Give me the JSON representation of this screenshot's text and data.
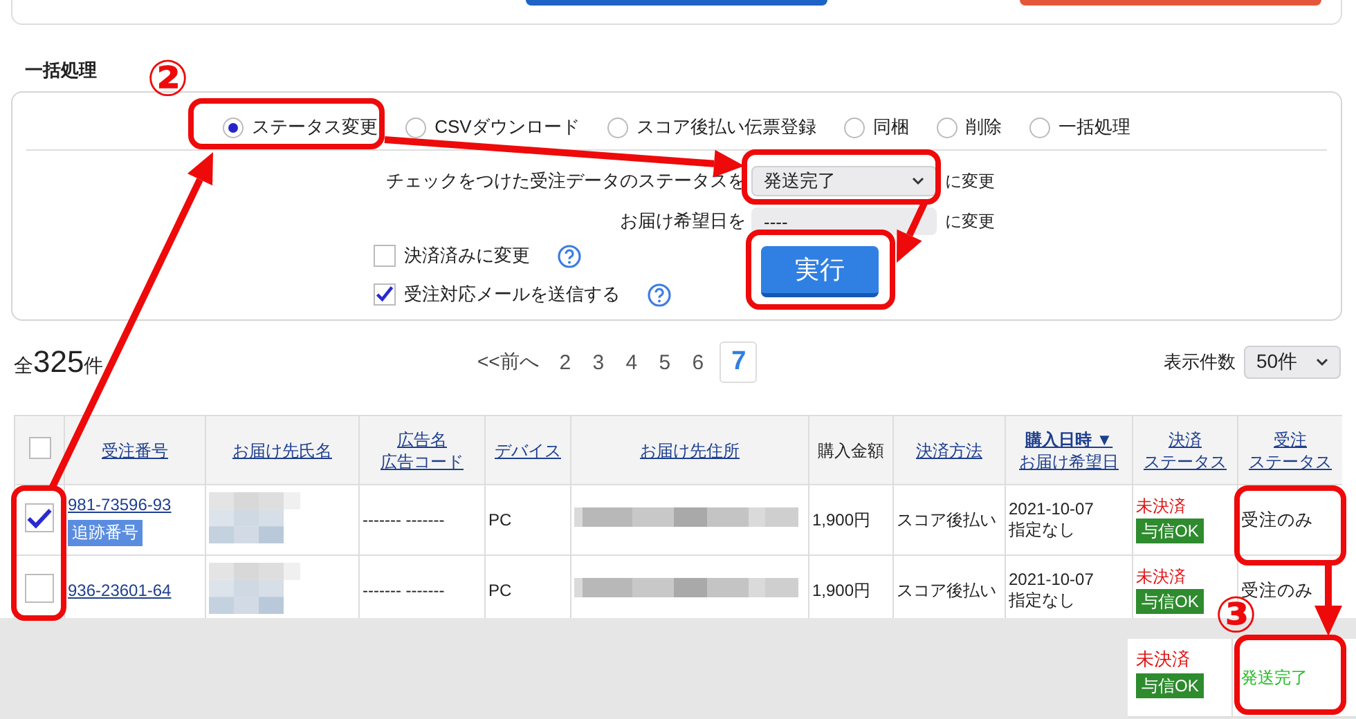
{
  "bulk": {
    "heading": "一括処理",
    "modes": [
      {
        "label": "ステータス変更",
        "selected": true
      },
      {
        "label": "CSVダウンロード",
        "selected": false
      },
      {
        "label": "スコア後払い伝票登録",
        "selected": false
      },
      {
        "label": "同梱",
        "selected": false
      },
      {
        "label": "削除",
        "selected": false
      },
      {
        "label": "一括処理",
        "selected": false
      }
    ],
    "status_row": {
      "label": "チェックをつけた受注データのステータスを",
      "value": "発送完了",
      "suffix": "に変更"
    },
    "date_row": {
      "label": "お届け希望日を",
      "value": "----",
      "suffix": "に変更"
    },
    "options": [
      {
        "label": "決済済みに変更",
        "checked": false
      },
      {
        "label": "受注対応メールを送信する",
        "checked": true
      }
    ],
    "run_button": "実行"
  },
  "summary": {
    "prefix": "全",
    "count": "325",
    "suffix": "件"
  },
  "pagination": {
    "prev": "<<前へ",
    "pages": [
      {
        "label": "2",
        "selected": false
      },
      {
        "label": "3",
        "selected": false
      },
      {
        "label": "4",
        "selected": false
      },
      {
        "label": "5",
        "selected": false
      },
      {
        "label": "6",
        "selected": false
      },
      {
        "label": "7",
        "selected": true
      }
    ]
  },
  "page_size": {
    "label": "表示件数",
    "value": "50件"
  },
  "table": {
    "header_checkbox": {
      "checked": false
    },
    "columns": [
      {
        "lines": [
          "受注番号"
        ],
        "link": true
      },
      {
        "lines": [
          "お届け先氏名"
        ],
        "link": true
      },
      {
        "lines": [
          "広告名",
          "広告コード"
        ],
        "link": true
      },
      {
        "lines": [
          "デバイス"
        ],
        "link": true
      },
      {
        "lines": [
          "お届け先住所"
        ],
        "link": true
      },
      {
        "lines": [
          "購入金額"
        ],
        "link": false
      },
      {
        "lines": [
          "決済方法"
        ],
        "link": true
      },
      {
        "lines": [
          "**購入日時 ▼**",
          "お届け希望日"
        ],
        "link": true
      },
      {
        "lines": [
          "決済",
          "ステータス"
        ],
        "link": true
      },
      {
        "lines": [
          "受注",
          "ステータス"
        ],
        "link": true
      }
    ],
    "rows": [
      {
        "checked": true,
        "order_no": "981-73596-93",
        "tracking": "追跡番号",
        "name_blurred": true,
        "ad": "------- -------",
        "device": "PC",
        "address_blurred": true,
        "amount": "1,900円",
        "method": "スコア後払い",
        "date": "2021-10-07",
        "delivery": "指定なし",
        "payment_status": "未決済",
        "credit": "与信OK",
        "order_status": {
          "label": "受注のみ",
          "color": "#222222"
        }
      },
      {
        "checked": false,
        "order_no": "936-23601-64",
        "name_blurred": true,
        "ad": "------- -------",
        "device": "PC",
        "address_blurred": true,
        "amount": "1,900円",
        "method": "スコア後払い",
        "date": "2021-10-07",
        "delivery": "指定なし",
        "payment_status": "未決済",
        "credit": "与信OK",
        "order_status": {
          "label": "受注のみ",
          "color": "#222222"
        }
      }
    ]
  },
  "preview": {
    "payment_status": "未決済",
    "credit": "与信OK",
    "order_status": {
      "label": "発送完了",
      "color": "#22bb22"
    }
  },
  "annotations": [
    "②",
    "③"
  ]
}
